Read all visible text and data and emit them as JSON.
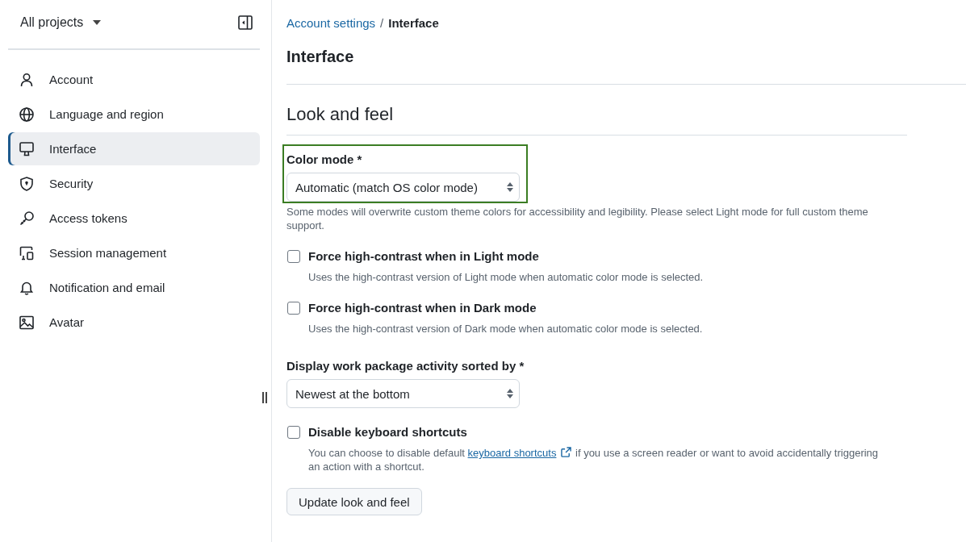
{
  "sidebar": {
    "project_selector": "All projects",
    "items": [
      {
        "label": "Account",
        "selected": false
      },
      {
        "label": "Language and region",
        "selected": false
      },
      {
        "label": "Interface",
        "selected": true
      },
      {
        "label": "Security",
        "selected": false
      },
      {
        "label": "Access tokens",
        "selected": false
      },
      {
        "label": "Session management",
        "selected": false
      },
      {
        "label": "Notification and email",
        "selected": false
      },
      {
        "label": "Avatar",
        "selected": false
      }
    ]
  },
  "breadcrumb": {
    "items": [
      {
        "label": "Account settings",
        "kind": "link"
      },
      {
        "label": "Interface",
        "kind": "current"
      }
    ],
    "separator": "/"
  },
  "page_title": "Interface",
  "section": {
    "title": "Look and feel",
    "fields": [
      {
        "kind": "select",
        "label": "Color mode *",
        "value": "Automatic (match OS color mode)",
        "highlighted": true,
        "hint": "Some modes will overwrite custom theme colors for accessibility and legibility. Please select Light mode for full custom theme support."
      },
      {
        "kind": "checkbox",
        "label": "Force high-contrast when in Light mode",
        "checked": false,
        "hint": "Uses the high-contrast version of Light mode when automatic color mode is selected."
      },
      {
        "kind": "checkbox",
        "label": "Force high-contrast when in Dark mode",
        "checked": false,
        "hint": "Uses the high-contrast version of Dark mode when automatic color mode is selected."
      },
      {
        "kind": "select",
        "label": "Display work package activity sorted by *",
        "value": "Newest at the bottom",
        "highlighted": false
      },
      {
        "kind": "checkbox",
        "label": "Disable keyboard shortcuts",
        "checked": false,
        "hint_parts": [
          {
            "kind": "text",
            "text": "You can choose to disable default "
          },
          {
            "kind": "link",
            "text": "keyboard shortcuts"
          },
          {
            "kind": "text",
            "text": " if you use a screen reader or want to avoid accidentally triggering an action with a shortcut."
          }
        ]
      }
    ],
    "submit_button": "Update look and feel"
  }
}
